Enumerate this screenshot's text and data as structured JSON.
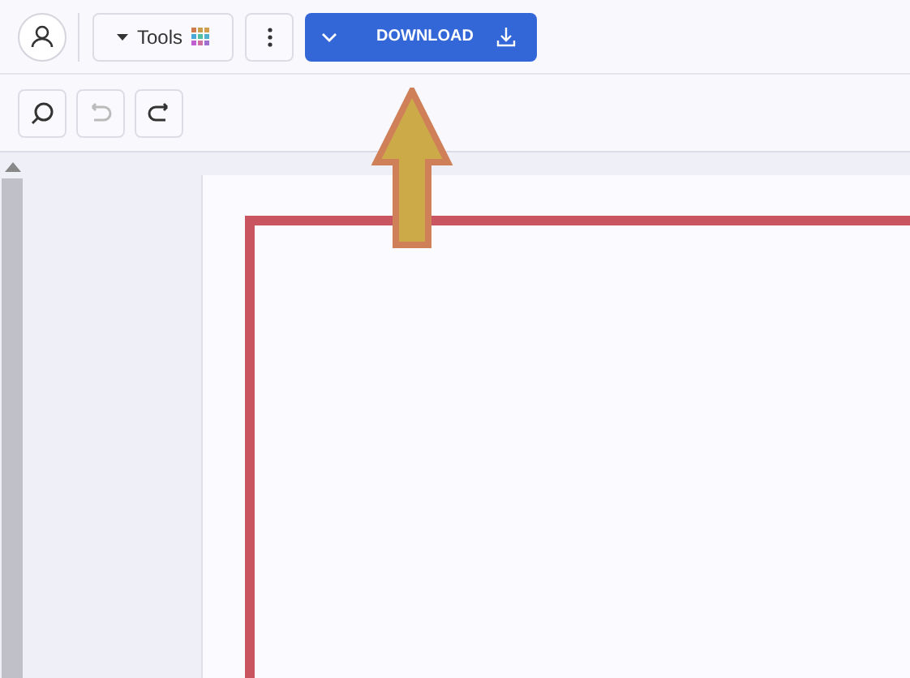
{
  "toolbar": {
    "tools_button": {
      "label": "Tools"
    },
    "download_button": {
      "label": "DOWNLOAD"
    }
  },
  "edit_tools": [
    {
      "kind": "search",
      "disabled": false
    },
    {
      "kind": "undo",
      "disabled": true
    },
    {
      "kind": "redo",
      "disabled": false
    }
  ]
}
